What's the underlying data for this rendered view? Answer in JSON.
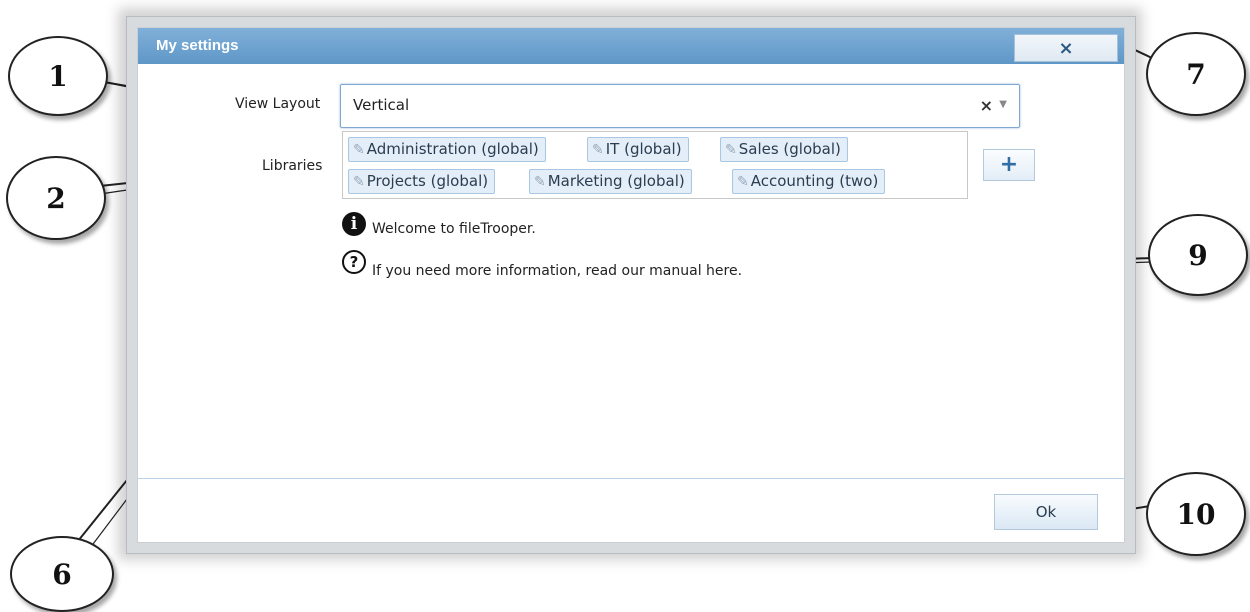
{
  "dialog": {
    "title": "My settings",
    "close_label": "×",
    "view_layout_label": "View Layout",
    "view_layout_value": "Vertical",
    "clear_label": "×",
    "dropdown_label": "▼",
    "libraries_label": "Libraries",
    "libraries": [
      "Administration (global)",
      "IT (global)",
      "Sales (global)",
      "Projects (global)",
      "Marketing (global)",
      "Accounting (two)"
    ],
    "add_label": "+",
    "info_icon": "i",
    "help_icon": "?",
    "welcome_text": "Welcome to fileTrooper.",
    "help_text": "If you need more information, read our manual here.",
    "ok_label": "Ok"
  },
  "callouts": {
    "c1": "1",
    "c2": "2",
    "c6": "6",
    "c7": "7",
    "c9": "9",
    "c10": "10"
  }
}
